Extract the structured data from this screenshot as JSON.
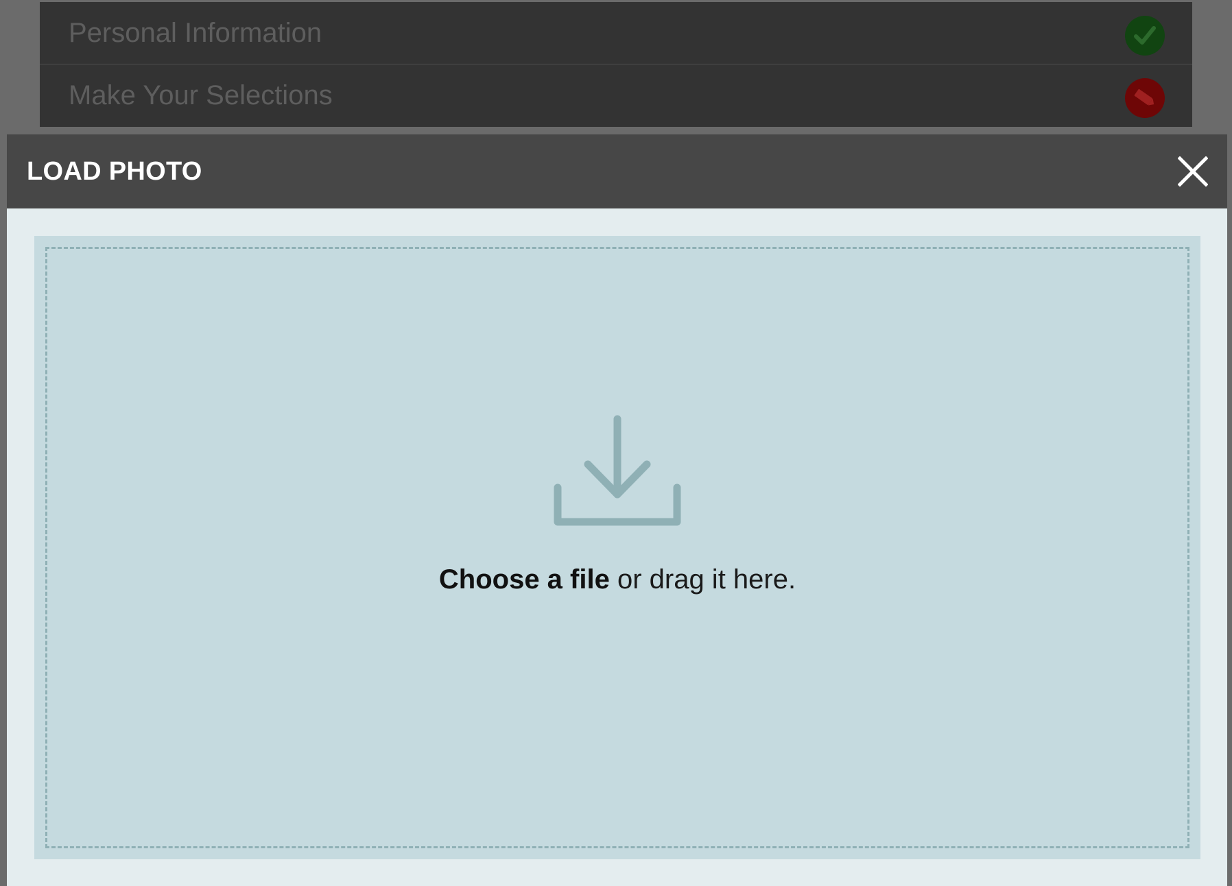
{
  "accordion": {
    "items": [
      {
        "label": "Personal Information",
        "status_icon": "checkmark-icon",
        "status_color": "#114411"
      },
      {
        "label": "Make Your Selections",
        "status_icon": "pencil-icon",
        "status_color": "#6e0606"
      }
    ]
  },
  "modal": {
    "title": "LOAD PHOTO",
    "close_icon": "close-icon",
    "dropzone": {
      "icon": "download-tray-icon",
      "choose_label": "Choose a file",
      "drag_text": " or drag it here."
    }
  },
  "colors": {
    "header_bg": "#474747",
    "modal_bg": "#e4edef",
    "dropzone_bg": "#c5dadf",
    "dropzone_border": "#8fb0b5",
    "icon_color": "#8fb0b5"
  }
}
